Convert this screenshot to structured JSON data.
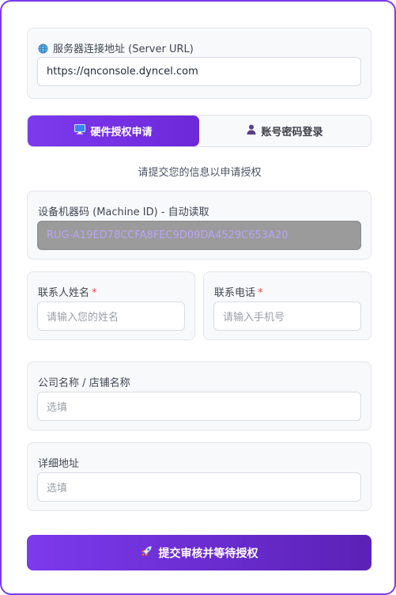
{
  "server": {
    "label": "服务器连接地址 (Server URL)",
    "value": "https://qnconsole.dyncel.com"
  },
  "tabs": [
    {
      "label": "硬件授权申请",
      "icon": "monitor-icon",
      "active": true
    },
    {
      "label": "账号密码登录",
      "icon": "user-icon",
      "active": false
    }
  ],
  "subtitle": "请提交您的信息以申请授权",
  "machine": {
    "label": "设备机器码 (Machine ID) - 自动读取",
    "value": "RUG-A19ED78CCFA8FEC9D09DA4529C653A20"
  },
  "contact_name": {
    "label": "联系人姓名",
    "required": "*",
    "placeholder": "请输入您的姓名"
  },
  "contact_phone": {
    "label": "联系电话",
    "required": "*",
    "placeholder": "请输入手机号"
  },
  "company": {
    "label": "公司名称 / 店铺名称",
    "placeholder": "选填"
  },
  "address": {
    "label": "详细地址",
    "placeholder": "选填"
  },
  "submit": {
    "label": "提交审核并等待授权",
    "icon": "rocket-icon"
  },
  "colors": {
    "accent": "#7c3aed",
    "required": "#ef4444"
  }
}
